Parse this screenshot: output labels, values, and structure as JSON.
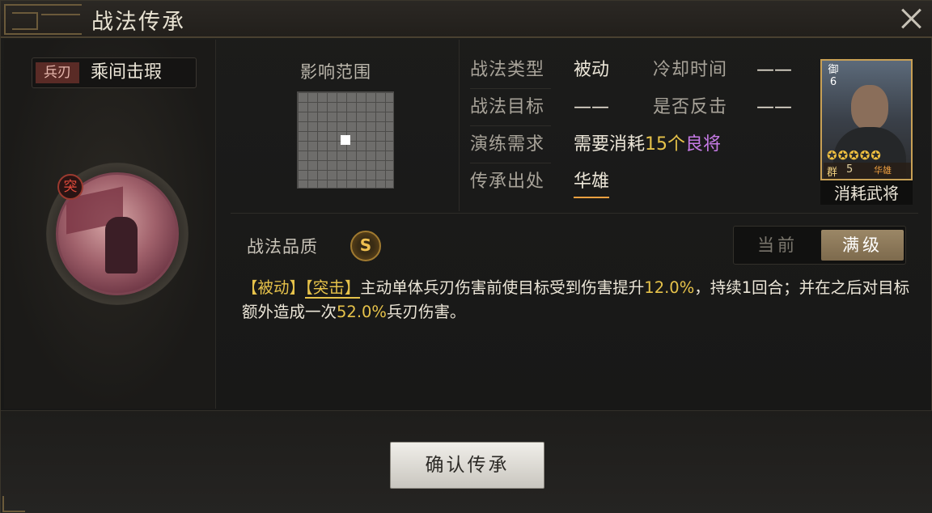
{
  "window": {
    "title": "战法传承",
    "close_icon": "close-icon"
  },
  "skill": {
    "type_tag": "兵刃",
    "name": "乘间击瑕",
    "portrait_badge": "突"
  },
  "range": {
    "title": "影响范围",
    "grid_size": 10
  },
  "info": {
    "type_label": "战法类型",
    "type_value": "被动",
    "cooldown_label": "冷却时间",
    "cooldown_value": "——",
    "target_label": "战法目标",
    "target_value": "——",
    "counter_label": "是否反击",
    "counter_value": "——",
    "train_label": "演练需求",
    "train_prefix": "需要消耗",
    "train_count": "15个",
    "train_item": "良将",
    "source_label": "传承出处",
    "source_value": "华雄"
  },
  "general_card": {
    "cost": "御6",
    "faction": "群",
    "level": "5",
    "name": "华雄",
    "stars": "✪✪✪✪✪",
    "caption": "消耗武将",
    "colors": {
      "border": "#c8a055",
      "stars": "#f0c040"
    }
  },
  "quality": {
    "label": "战法品质",
    "grade": "S"
  },
  "toggle": {
    "current_label": "当前",
    "max_label": "满级"
  },
  "description": {
    "tag1": "【被动】",
    "tag2": "【突击】",
    "text1": "主动单体兵刃伤害前使目标受到伤害提升",
    "num1": "12.0%",
    "text2": "，持续1回合；并在之后对目标额外造成一次",
    "num2": "52.0%",
    "text3": "兵刃伤害。"
  },
  "footer": {
    "confirm_label": "确认传承"
  },
  "colors": {
    "highlight_yellow": "#e6c24a",
    "highlight_purple": "#c67ae6",
    "highlight_orange": "#f0a040"
  }
}
